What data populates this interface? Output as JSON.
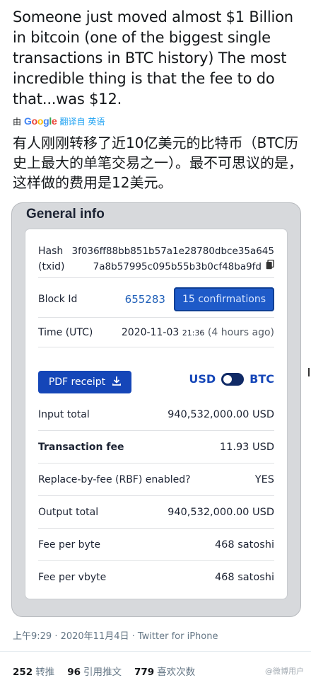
{
  "tweet": {
    "text": "Someone just moved almost $1 Billion in bitcoin (one of the biggest single transactions in BTC history) The most incredible thing is that the fee to do that...was $12.",
    "translate_by": "由",
    "google_letters": [
      "G",
      "o",
      "o",
      "g",
      "l",
      "e"
    ],
    "translate_link": "翻译自 英语",
    "translated_text": "有人刚刚转移了近10亿美元的比特币（BTC历史上最大的单笔交易之一）。最不可思议的是，这样做的费用是12美元。"
  },
  "card": {
    "title": "General info",
    "hash_label_1": "Hash",
    "hash_label_2": "(txid)",
    "hash_line_1": "3f036ff88bb851b57a1e28780dbce35a645",
    "hash_line_2": "7a8b57995c095b55b3b0cf48ba9fd",
    "block_label": "Block Id",
    "block_value": "655283",
    "confirmations": "15 confirmations",
    "time_label": "Time (UTC)",
    "time_date": "2020-11-03",
    "time_clock": "21:36",
    "time_ago": "(4 hours ago)",
    "pdf_label": "PDF receipt",
    "currency_left": "USD",
    "currency_right": "BTC",
    "rows": [
      {
        "label": "Input total",
        "value": "940,532,000.00 USD"
      },
      {
        "label": "Transaction fee",
        "value": "11.93 USD"
      },
      {
        "label": "Replace-by-fee (RBF) enabled?",
        "value": "YES"
      },
      {
        "label": "Output total",
        "value": "940,532,000.00 USD"
      },
      {
        "label": "Fee per byte",
        "value": "468 satoshi"
      },
      {
        "label": "Fee per vbyte",
        "value": "468 satoshi"
      }
    ]
  },
  "meta": {
    "timestamp": "上午9:29 · 2020年11月4日 · Twitter for iPhone"
  },
  "stats": {
    "retweets_count": "252",
    "retweets_label": "转推",
    "quotes_count": "96",
    "quotes_label": "引用推文",
    "likes_count": "779",
    "likes_label": "喜欢次数"
  },
  "watermark": "@微博用户",
  "colors": {
    "link": "#1da1f2",
    "button": "#1546b8",
    "card_bg": "#d7d9dc"
  }
}
